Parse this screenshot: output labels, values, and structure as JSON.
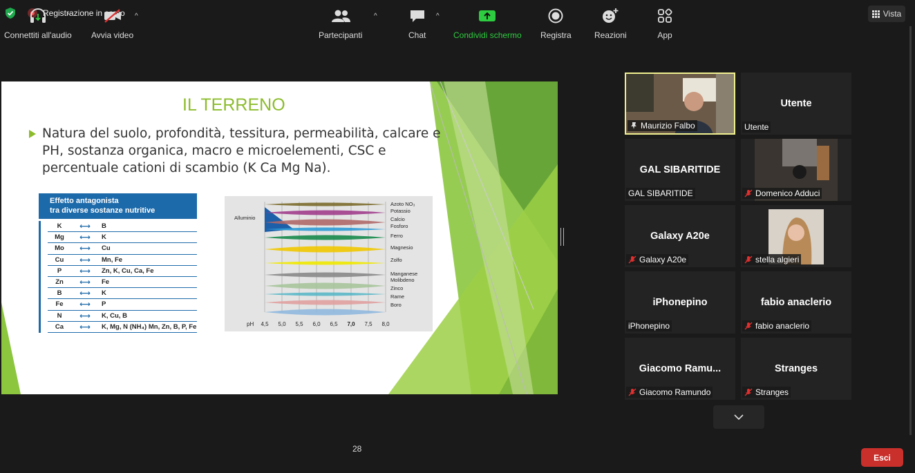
{
  "topbar": {
    "recording_label": "Registrazione in corso",
    "view_label": "Vista"
  },
  "slide": {
    "title": "IL TERRENO",
    "bullet": "Natura del suolo, profondità, tessitura, permeabilità, calcare e PH, sostanza organica, macro e microelementi, CSC e percentuale cationi di scambio (K Ca Mg Na).",
    "antagonist_table": {
      "header_line1": "Effetto antagonista",
      "header_line2": "tra diverse sostanze nutritive",
      "rows": [
        {
          "a": "K",
          "b": "B"
        },
        {
          "a": "Mg",
          "b": "K"
        },
        {
          "a": "Mo",
          "b": "Cu"
        },
        {
          "a": "Cu",
          "b": "Mn, Fe"
        },
        {
          "a": "P",
          "b": "Zn, K, Cu, Ca, Fe"
        },
        {
          "a": "Zn",
          "b": "Fe"
        },
        {
          "a": "B",
          "b": "K"
        },
        {
          "a": "Fe",
          "b": "P"
        },
        {
          "a": "N",
          "b": "K, Cu, B"
        },
        {
          "a": "Ca",
          "b": "K, Mg, N (NH₄) Mn, Zn, B, P, Fe"
        }
      ]
    },
    "ph_chart": {
      "left_label": "Alluminio",
      "nutrients": [
        "Azoto NO₃",
        "Potassio",
        "Calcio",
        "Fosforo",
        "Ferro",
        "Magnesio",
        "Zolfo",
        "Manganese",
        "Molibdeno",
        "Zinco",
        "Rame",
        "Boro"
      ],
      "axis_label": "pH",
      "ticks": [
        "4,5",
        "5,0",
        "5,5",
        "6,0",
        "6,5",
        "7,0",
        "7,5",
        "8,0"
      ]
    }
  },
  "participants": [
    {
      "center": "",
      "label": "Maurizio Falbo",
      "muted": false,
      "video": true,
      "active": true
    },
    {
      "center": "Utente",
      "label": "Utente",
      "muted": false,
      "video": false,
      "active": false
    },
    {
      "center": "GAL SIBARITIDE",
      "label": "GAL SIBARITIDE",
      "muted": false,
      "video": false,
      "active": false
    },
    {
      "center": "",
      "label": "Domenico Adduci",
      "muted": true,
      "video": true,
      "active": false
    },
    {
      "center": "Galaxy A20e",
      "label": "Galaxy A20e",
      "muted": true,
      "video": false,
      "active": false
    },
    {
      "center": "",
      "label": "stella algieri",
      "muted": true,
      "video": true,
      "active": false
    },
    {
      "center": "iPhonepino",
      "label": "iPhonepino",
      "muted": false,
      "video": false,
      "active": false
    },
    {
      "center": "fabio anaclerio",
      "label": "fabio anaclerio",
      "muted": true,
      "video": false,
      "active": false
    },
    {
      "center": "Giacomo  Ramu...",
      "label": "Giacomo Ramundo",
      "muted": true,
      "video": false,
      "active": false
    },
    {
      "center": "Stranges",
      "label": "Stranges",
      "muted": true,
      "video": false,
      "active": false
    }
  ],
  "toolbar": {
    "audio": "Connettiti all'audio",
    "video": "Avvia video",
    "participants": "Partecipanti",
    "participants_count": "28",
    "chat": "Chat",
    "share": "Condividi schermo",
    "record": "Registra",
    "reactions": "Reazioni",
    "apps": "App",
    "exit": "Esci"
  },
  "colors": {
    "accent_green": "#8cbc2c",
    "share_green": "#2ecc40",
    "exit_red": "#c9302c",
    "table_blue": "#1d6aaa"
  }
}
